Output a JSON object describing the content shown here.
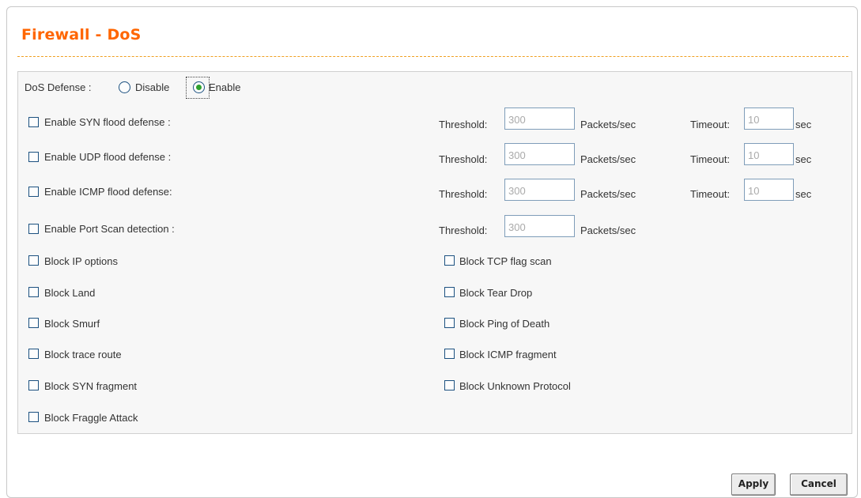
{
  "page": {
    "title": "Firewall - DoS"
  },
  "dos_defense": {
    "label": "DoS Defense :",
    "options": [
      {
        "label": "Disable",
        "selected": false
      },
      {
        "label": "Enable",
        "selected": true
      }
    ]
  },
  "flood": {
    "threshold_label": "Threshold:",
    "unit_label": "Packets/sec",
    "timeout_label": "Timeout:",
    "timeout_unit": "sec",
    "rows": [
      {
        "label": "Enable SYN flood defense :",
        "checked": false,
        "threshold": "300",
        "timeout": "10"
      },
      {
        "label": "Enable UDP flood defense :",
        "checked": false,
        "threshold": "300",
        "timeout": "10"
      },
      {
        "label": "Enable ICMP flood defense:",
        "checked": false,
        "threshold": "300",
        "timeout": "10"
      },
      {
        "label": "Enable Port Scan detection :",
        "checked": false,
        "threshold": "300"
      }
    ]
  },
  "blocks": {
    "left": [
      {
        "label": "Block IP options",
        "checked": false
      },
      {
        "label": "Block Land",
        "checked": false
      },
      {
        "label": "Block Smurf",
        "checked": false
      },
      {
        "label": "Block trace route",
        "checked": false
      },
      {
        "label": "Block SYN fragment",
        "checked": false
      },
      {
        "label": "Block Fraggle Attack",
        "checked": false
      }
    ],
    "right": [
      {
        "label": "Block TCP flag scan",
        "checked": false
      },
      {
        "label": "Block Tear Drop",
        "checked": false
      },
      {
        "label": "Block Ping of Death",
        "checked": false
      },
      {
        "label": "Block ICMP fragment",
        "checked": false
      },
      {
        "label": "Block Unknown Protocol",
        "checked": false
      }
    ]
  },
  "buttons": {
    "apply": "Apply",
    "cancel": "Cancel"
  }
}
